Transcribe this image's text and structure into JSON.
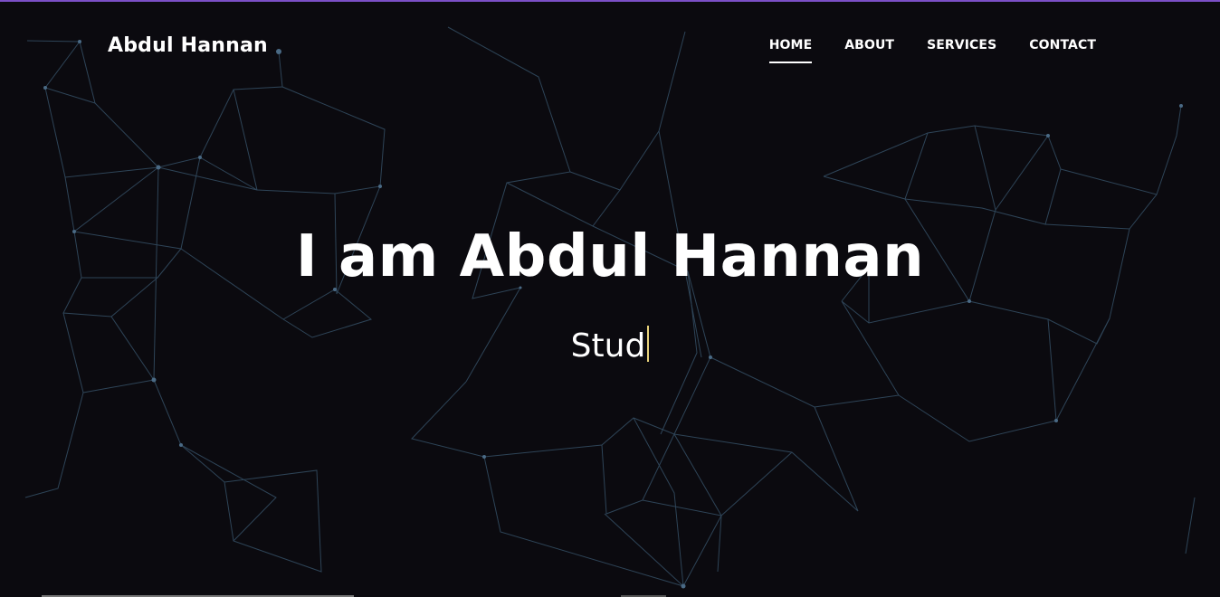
{
  "brand": {
    "name": "Abdul Hannan"
  },
  "nav": {
    "items": [
      {
        "label": "HOME",
        "active": true
      },
      {
        "label": "ABOUT",
        "active": false
      },
      {
        "label": "SERVICES",
        "active": false
      },
      {
        "label": "CONTACT",
        "active": false
      }
    ]
  },
  "hero": {
    "title": "I am Abdul Hannan",
    "typed_text": "Stud"
  },
  "colors": {
    "background": "#0b0a0f",
    "accent_line": "#7b4fc6",
    "network_lines": "#3a5870",
    "cursor": "#e8d27a"
  }
}
